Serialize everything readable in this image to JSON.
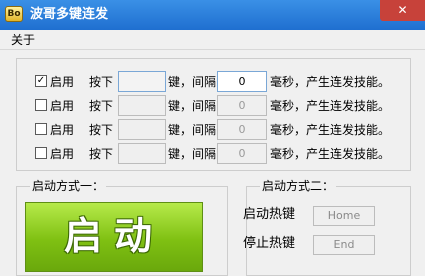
{
  "window": {
    "title": "波哥多键连发",
    "icon_text": "Bo",
    "close_glyph": "✕"
  },
  "menu": {
    "items": [
      "关于"
    ]
  },
  "rows": [
    {
      "checked": true,
      "enable_label": "启用",
      "press_label": "按下",
      "key_value": "",
      "interval_label": "键，间隔",
      "interval_value": "0",
      "suffix": "毫秒，产生连发技能。"
    },
    {
      "checked": false,
      "enable_label": "启用",
      "press_label": "按下",
      "key_value": "",
      "interval_label": "键，间隔",
      "interval_value": "0",
      "suffix": "毫秒，产生连发技能。"
    },
    {
      "checked": false,
      "enable_label": "启用",
      "press_label": "按下",
      "key_value": "",
      "interval_label": "键，间隔",
      "interval_value": "0",
      "suffix": "毫秒，产生连发技能。"
    },
    {
      "checked": false,
      "enable_label": "启用",
      "press_label": "按下",
      "key_value": "",
      "interval_label": "键，间隔",
      "interval_value": "0",
      "suffix": "毫秒，产生连发技能。"
    }
  ],
  "start_mode1": {
    "legend": "启动方式一：",
    "button_label": "启动"
  },
  "start_mode2": {
    "legend": "启动方式二：",
    "start_hotkey_label": "启动热键",
    "start_hotkey_value": "Home",
    "stop_hotkey_label": "停止热键",
    "stop_hotkey_value": "End"
  }
}
